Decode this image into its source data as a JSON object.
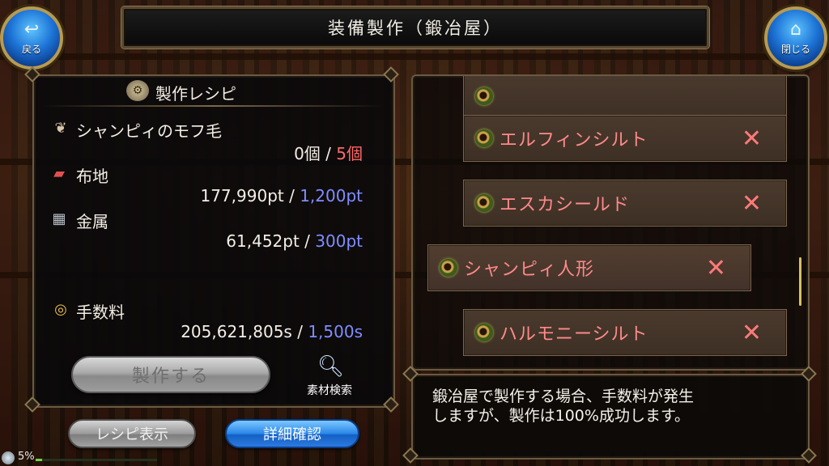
{
  "header": {
    "title": "装備製作（鍛冶屋）"
  },
  "nav": {
    "back_label": "戻る",
    "close_label": "閉じる"
  },
  "recipe": {
    "title": "製作レシピ",
    "materials": [
      {
        "name": "シャンピィのモフ毛",
        "have": "0個",
        "separator": "/",
        "need": "5個",
        "need_color": "red",
        "icon": "fur-icon"
      },
      {
        "name": "布地",
        "have": "177,990pt",
        "separator": "/",
        "need": "1,200pt",
        "need_color": "blue",
        "icon": "cloth-icon"
      },
      {
        "name": "金属",
        "have": "61,452pt",
        "separator": "/",
        "need": "300pt",
        "need_color": "blue",
        "icon": "metal-icon"
      }
    ],
    "fee": {
      "name": "手数料",
      "have": "205,621,805s",
      "separator": "/",
      "need": "1,500s",
      "icon": "coin-icon"
    },
    "make_button": "製作する",
    "search_label": "素材検索"
  },
  "bottom": {
    "recipe_view": "レシピ表示",
    "detail_confirm": "詳細確認"
  },
  "progress": {
    "percent_label": "5%",
    "value": 0.05
  },
  "list": {
    "items": [
      {
        "label": "エルフィンシルト",
        "mark": "✕"
      },
      {
        "label": "エスカシールド",
        "mark": "✕"
      },
      {
        "label": "シャンピィ人形",
        "mark": "✕"
      },
      {
        "label": "ハルモニーシルト",
        "mark": "✕"
      }
    ]
  },
  "message": {
    "line1": "鍛冶屋で製作する場合、手数料が発生",
    "line2": "しますが、製作は100%成功します。"
  },
  "colors": {
    "need_red": "#ff6a6a",
    "need_blue": "#7f8dff",
    "item_label": "#ff8a8a",
    "detail_button": "#2a86e8"
  }
}
